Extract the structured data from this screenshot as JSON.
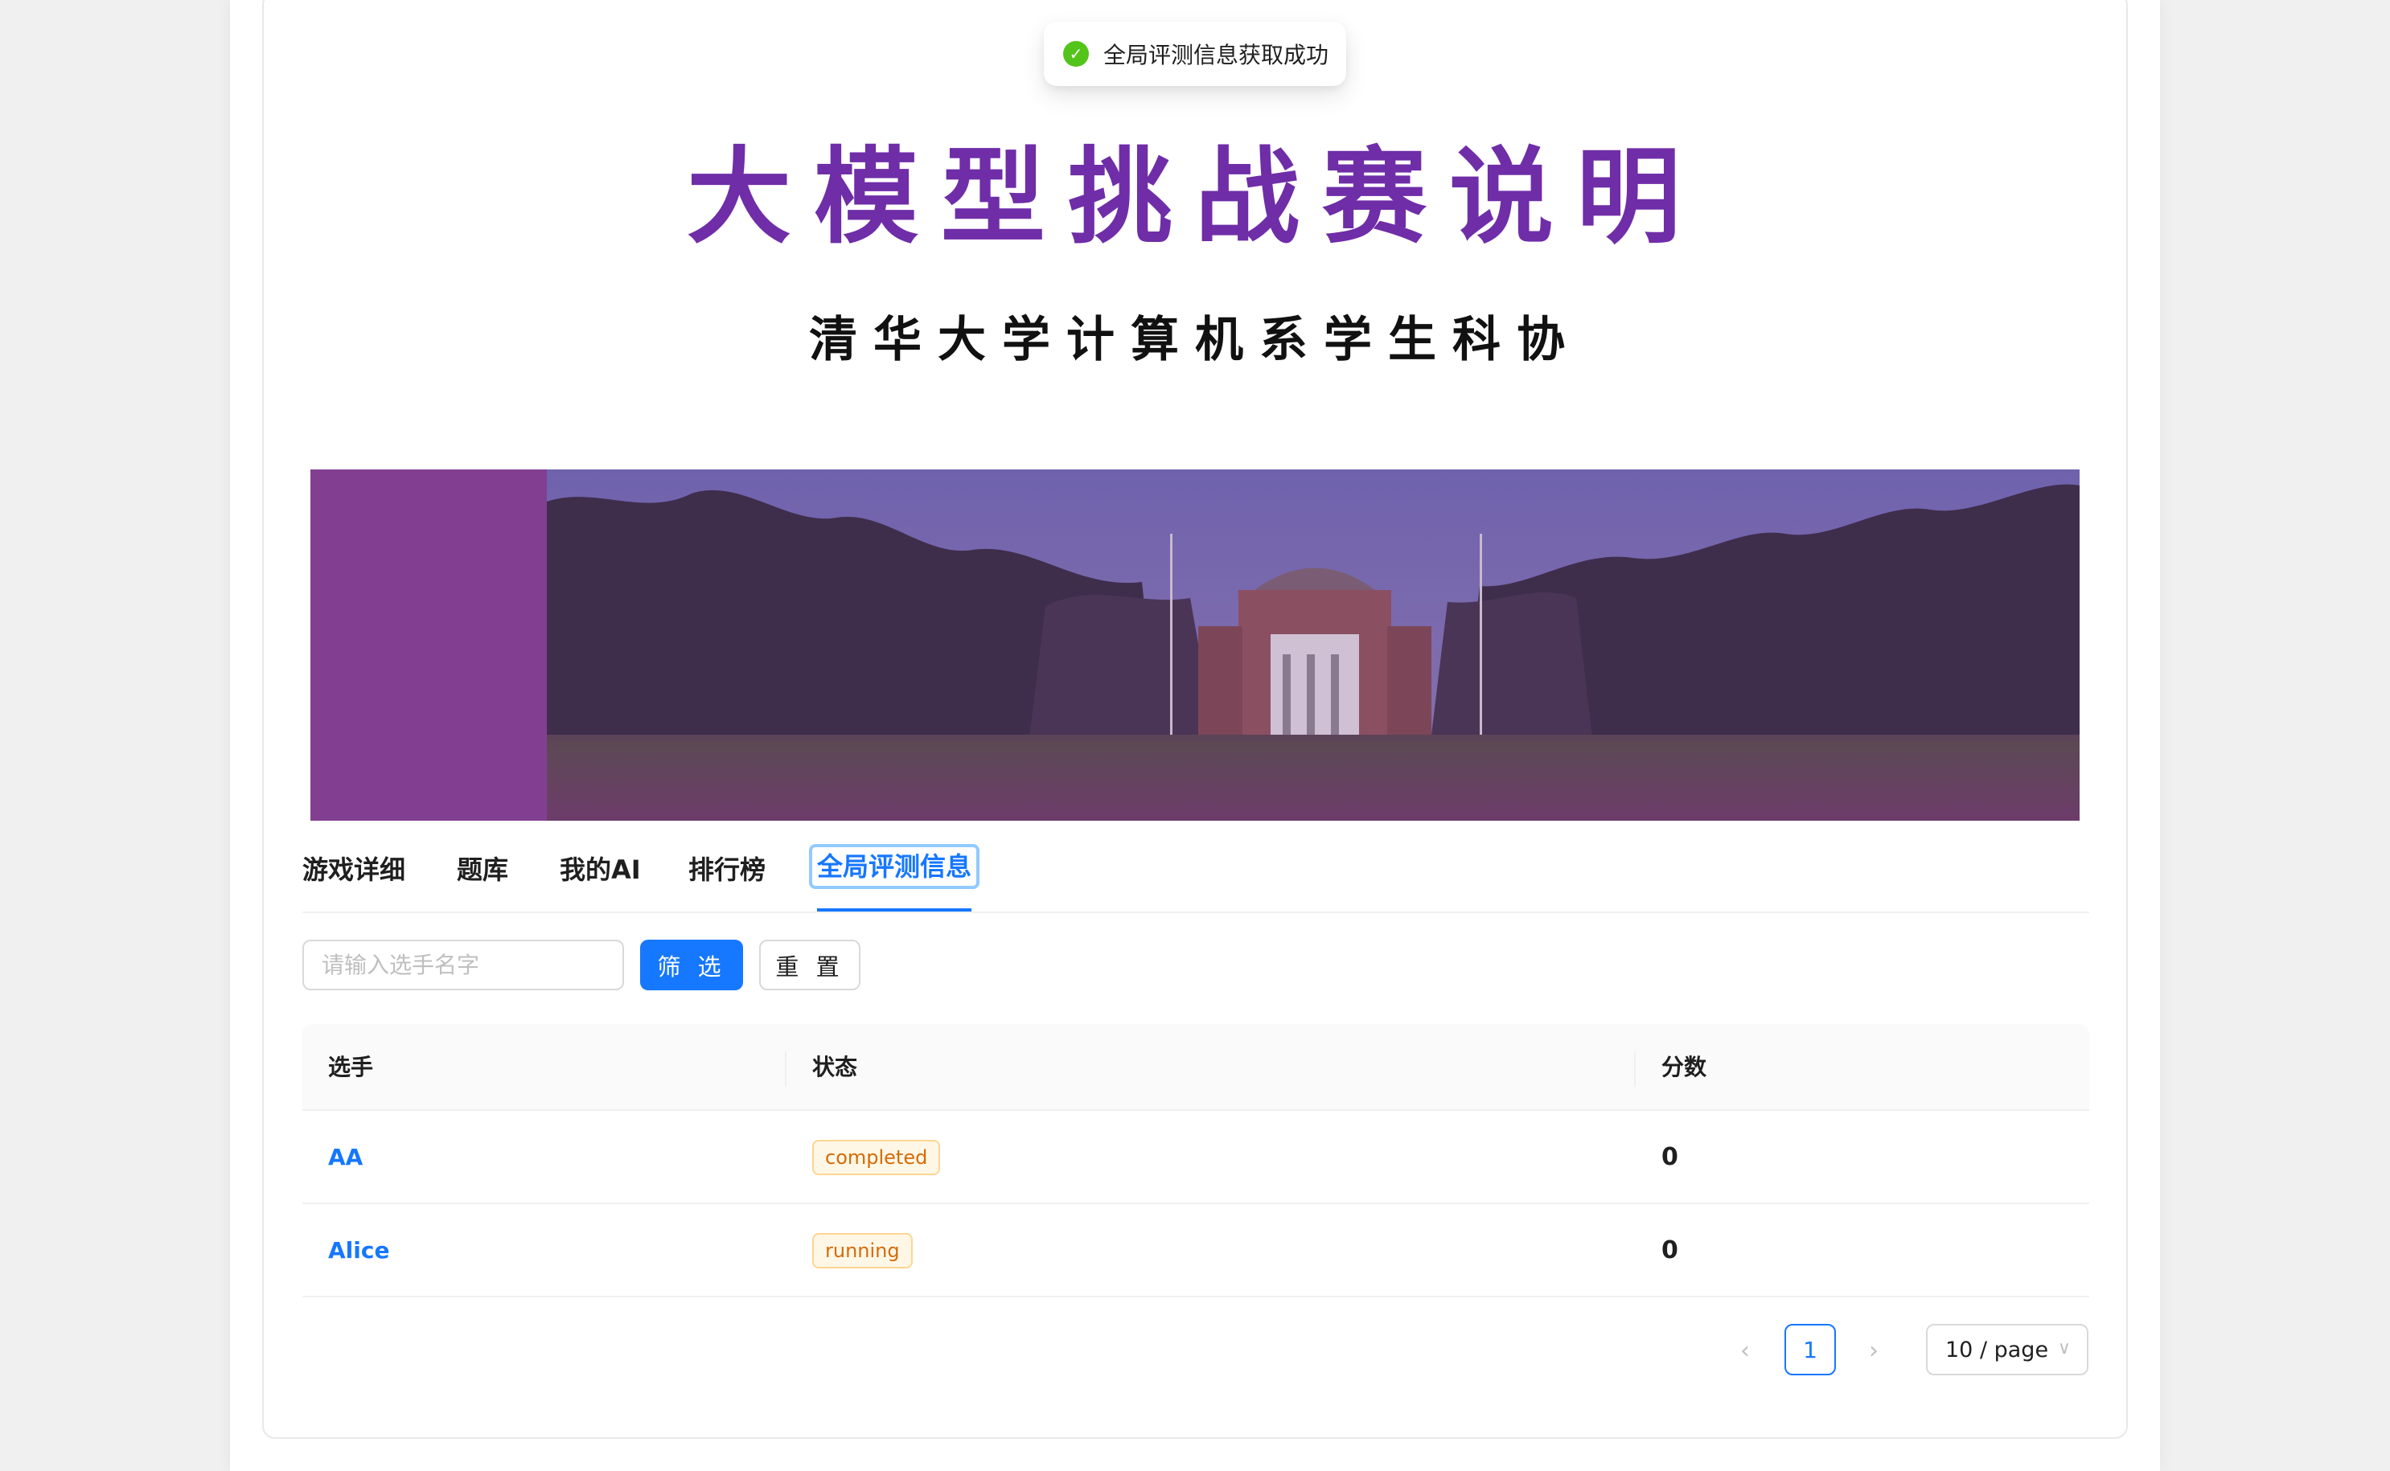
{
  "toast": {
    "message": "全局评测信息获取成功"
  },
  "header": {
    "title": "大模型挑战赛说明",
    "subtitle": "清华大学计算机系学生科协"
  },
  "tabs": [
    {
      "label": "游戏详细"
    },
    {
      "label": "题库"
    },
    {
      "label": "我的AI"
    },
    {
      "label": "排行榜"
    },
    {
      "label": "全局评测信息",
      "active": true
    }
  ],
  "filter": {
    "placeholder": "请输入选手名字",
    "filter_label": "筛 选",
    "reset_label": "重 置"
  },
  "table": {
    "columns": [
      "选手",
      "状态",
      "分数"
    ],
    "rows": [
      {
        "player": "AA",
        "status": "completed",
        "score": "0"
      },
      {
        "player": "Alice",
        "status": "running",
        "score": "0"
      }
    ]
  },
  "pagination": {
    "current_page": "1",
    "page_size": "10 / page"
  },
  "colors": {
    "primary": "#1677ff",
    "title_purple": "#6f2da8",
    "success": "#52c41a",
    "tag_orange": "#d46b08"
  }
}
